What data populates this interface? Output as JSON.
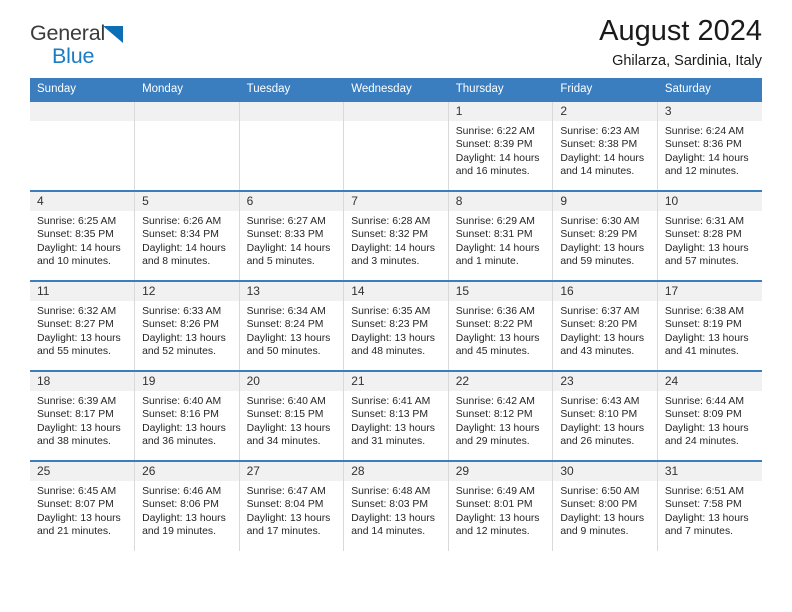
{
  "brand": {
    "name_part1": "General",
    "name_part2": "Blue",
    "triangle_icon": "triangle-icon",
    "accent_color": "#1a7dc4"
  },
  "header": {
    "title": "August 2024",
    "subtitle": "Ghilarza, Sardinia, Italy"
  },
  "calendar": {
    "header_bg": "#3a7ebf",
    "daynum_bg": "#f1f1f1",
    "weekdays": [
      "Sunday",
      "Monday",
      "Tuesday",
      "Wednesday",
      "Thursday",
      "Friday",
      "Saturday"
    ],
    "weeks": [
      [
        {
          "day": "",
          "lines": []
        },
        {
          "day": "",
          "lines": []
        },
        {
          "day": "",
          "lines": []
        },
        {
          "day": "",
          "lines": []
        },
        {
          "day": "1",
          "lines": [
            "Sunrise: 6:22 AM",
            "Sunset: 8:39 PM",
            "Daylight: 14 hours",
            "and 16 minutes."
          ]
        },
        {
          "day": "2",
          "lines": [
            "Sunrise: 6:23 AM",
            "Sunset: 8:38 PM",
            "Daylight: 14 hours",
            "and 14 minutes."
          ]
        },
        {
          "day": "3",
          "lines": [
            "Sunrise: 6:24 AM",
            "Sunset: 8:36 PM",
            "Daylight: 14 hours",
            "and 12 minutes."
          ]
        }
      ],
      [
        {
          "day": "4",
          "lines": [
            "Sunrise: 6:25 AM",
            "Sunset: 8:35 PM",
            "Daylight: 14 hours",
            "and 10 minutes."
          ]
        },
        {
          "day": "5",
          "lines": [
            "Sunrise: 6:26 AM",
            "Sunset: 8:34 PM",
            "Daylight: 14 hours",
            "and 8 minutes."
          ]
        },
        {
          "day": "6",
          "lines": [
            "Sunrise: 6:27 AM",
            "Sunset: 8:33 PM",
            "Daylight: 14 hours",
            "and 5 minutes."
          ]
        },
        {
          "day": "7",
          "lines": [
            "Sunrise: 6:28 AM",
            "Sunset: 8:32 PM",
            "Daylight: 14 hours",
            "and 3 minutes."
          ]
        },
        {
          "day": "8",
          "lines": [
            "Sunrise: 6:29 AM",
            "Sunset: 8:31 PM",
            "Daylight: 14 hours",
            "and 1 minute."
          ]
        },
        {
          "day": "9",
          "lines": [
            "Sunrise: 6:30 AM",
            "Sunset: 8:29 PM",
            "Daylight: 13 hours",
            "and 59 minutes."
          ]
        },
        {
          "day": "10",
          "lines": [
            "Sunrise: 6:31 AM",
            "Sunset: 8:28 PM",
            "Daylight: 13 hours",
            "and 57 minutes."
          ]
        }
      ],
      [
        {
          "day": "11",
          "lines": [
            "Sunrise: 6:32 AM",
            "Sunset: 8:27 PM",
            "Daylight: 13 hours",
            "and 55 minutes."
          ]
        },
        {
          "day": "12",
          "lines": [
            "Sunrise: 6:33 AM",
            "Sunset: 8:26 PM",
            "Daylight: 13 hours",
            "and 52 minutes."
          ]
        },
        {
          "day": "13",
          "lines": [
            "Sunrise: 6:34 AM",
            "Sunset: 8:24 PM",
            "Daylight: 13 hours",
            "and 50 minutes."
          ]
        },
        {
          "day": "14",
          "lines": [
            "Sunrise: 6:35 AM",
            "Sunset: 8:23 PM",
            "Daylight: 13 hours",
            "and 48 minutes."
          ]
        },
        {
          "day": "15",
          "lines": [
            "Sunrise: 6:36 AM",
            "Sunset: 8:22 PM",
            "Daylight: 13 hours",
            "and 45 minutes."
          ]
        },
        {
          "day": "16",
          "lines": [
            "Sunrise: 6:37 AM",
            "Sunset: 8:20 PM",
            "Daylight: 13 hours",
            "and 43 minutes."
          ]
        },
        {
          "day": "17",
          "lines": [
            "Sunrise: 6:38 AM",
            "Sunset: 8:19 PM",
            "Daylight: 13 hours",
            "and 41 minutes."
          ]
        }
      ],
      [
        {
          "day": "18",
          "lines": [
            "Sunrise: 6:39 AM",
            "Sunset: 8:17 PM",
            "Daylight: 13 hours",
            "and 38 minutes."
          ]
        },
        {
          "day": "19",
          "lines": [
            "Sunrise: 6:40 AM",
            "Sunset: 8:16 PM",
            "Daylight: 13 hours",
            "and 36 minutes."
          ]
        },
        {
          "day": "20",
          "lines": [
            "Sunrise: 6:40 AM",
            "Sunset: 8:15 PM",
            "Daylight: 13 hours",
            "and 34 minutes."
          ]
        },
        {
          "day": "21",
          "lines": [
            "Sunrise: 6:41 AM",
            "Sunset: 8:13 PM",
            "Daylight: 13 hours",
            "and 31 minutes."
          ]
        },
        {
          "day": "22",
          "lines": [
            "Sunrise: 6:42 AM",
            "Sunset: 8:12 PM",
            "Daylight: 13 hours",
            "and 29 minutes."
          ]
        },
        {
          "day": "23",
          "lines": [
            "Sunrise: 6:43 AM",
            "Sunset: 8:10 PM",
            "Daylight: 13 hours",
            "and 26 minutes."
          ]
        },
        {
          "day": "24",
          "lines": [
            "Sunrise: 6:44 AM",
            "Sunset: 8:09 PM",
            "Daylight: 13 hours",
            "and 24 minutes."
          ]
        }
      ],
      [
        {
          "day": "25",
          "lines": [
            "Sunrise: 6:45 AM",
            "Sunset: 8:07 PM",
            "Daylight: 13 hours",
            "and 21 minutes."
          ]
        },
        {
          "day": "26",
          "lines": [
            "Sunrise: 6:46 AM",
            "Sunset: 8:06 PM",
            "Daylight: 13 hours",
            "and 19 minutes."
          ]
        },
        {
          "day": "27",
          "lines": [
            "Sunrise: 6:47 AM",
            "Sunset: 8:04 PM",
            "Daylight: 13 hours",
            "and 17 minutes."
          ]
        },
        {
          "day": "28",
          "lines": [
            "Sunrise: 6:48 AM",
            "Sunset: 8:03 PM",
            "Daylight: 13 hours",
            "and 14 minutes."
          ]
        },
        {
          "day": "29",
          "lines": [
            "Sunrise: 6:49 AM",
            "Sunset: 8:01 PM",
            "Daylight: 13 hours",
            "and 12 minutes."
          ]
        },
        {
          "day": "30",
          "lines": [
            "Sunrise: 6:50 AM",
            "Sunset: 8:00 PM",
            "Daylight: 13 hours",
            "and 9 minutes."
          ]
        },
        {
          "day": "31",
          "lines": [
            "Sunrise: 6:51 AM",
            "Sunset: 7:58 PM",
            "Daylight: 13 hours",
            "and 7 minutes."
          ]
        }
      ]
    ]
  }
}
